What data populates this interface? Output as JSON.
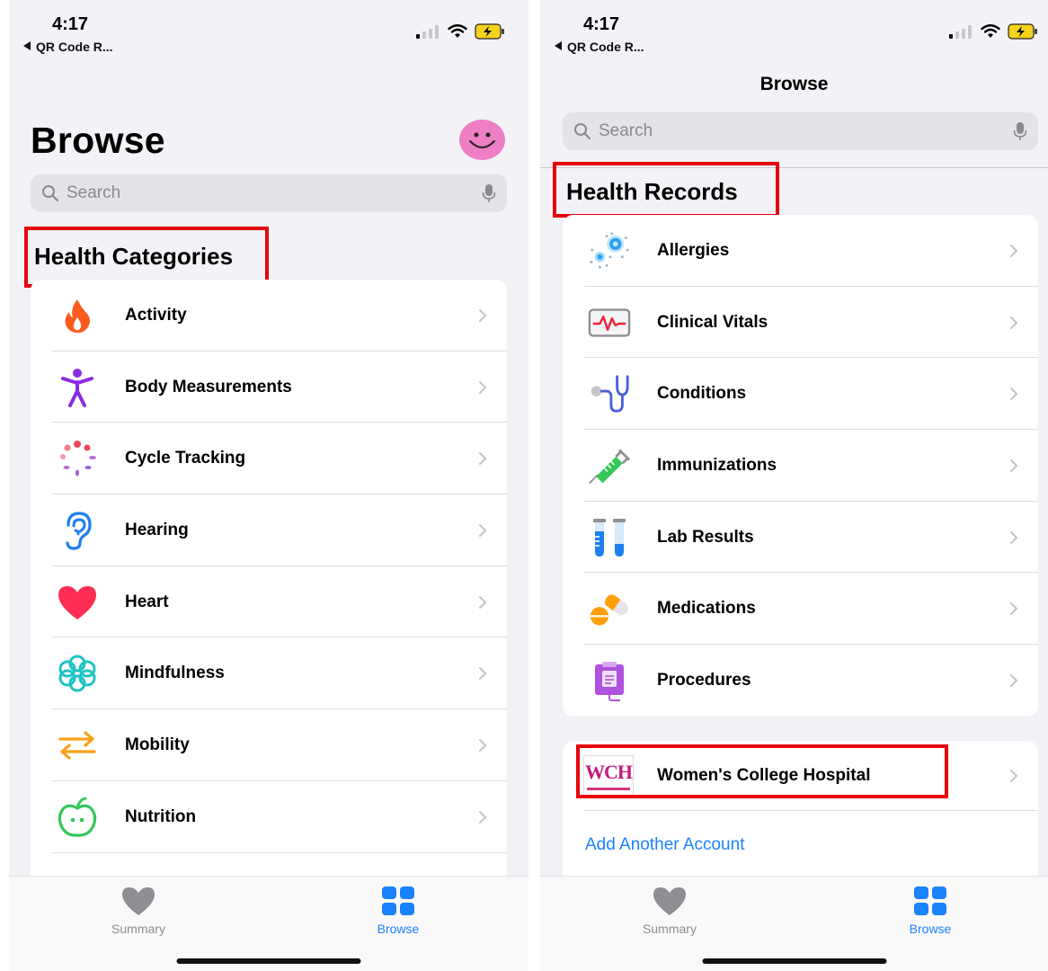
{
  "status": {
    "time": "4:17",
    "back_app": "QR Code R..."
  },
  "left_screen": {
    "title": "Browse",
    "search_placeholder": "Search",
    "section_header": "Health Categories",
    "categories": [
      {
        "label": "Activity",
        "icon": "flame-icon"
      },
      {
        "label": "Body Measurements",
        "icon": "person-figure-icon"
      },
      {
        "label": "Cycle Tracking",
        "icon": "cycle-dots-icon"
      },
      {
        "label": "Hearing",
        "icon": "ear-icon"
      },
      {
        "label": "Heart",
        "icon": "heart-icon"
      },
      {
        "label": "Mindfulness",
        "icon": "mindfulness-flower-icon"
      },
      {
        "label": "Mobility",
        "icon": "mobility-arrows-icon"
      },
      {
        "label": "Nutrition",
        "icon": "apple-icon"
      }
    ]
  },
  "right_screen": {
    "title": "Browse",
    "search_placeholder": "Search",
    "section_header": "Health Records",
    "records": [
      {
        "label": "Allergies",
        "icon": "allergy-particles-icon"
      },
      {
        "label": "Clinical Vitals",
        "icon": "vitals-monitor-icon"
      },
      {
        "label": "Conditions",
        "icon": "stethoscope-icon"
      },
      {
        "label": "Immunizations",
        "icon": "syringe-icon"
      },
      {
        "label": "Lab Results",
        "icon": "test-tubes-icon"
      },
      {
        "label": "Medications",
        "icon": "pills-icon"
      },
      {
        "label": "Procedures",
        "icon": "clipboard-icon"
      }
    ],
    "account": {
      "hospital_name": "Women's College Hospital",
      "logo_text": "WCH",
      "add_account": "Add Another Account"
    }
  },
  "tab_bar": {
    "summary_label": "Summary",
    "browse_label": "Browse"
  },
  "colors": {
    "accent": "#1a82fb",
    "highlight_box": "#e8000d",
    "background": "#f2f2f7"
  }
}
